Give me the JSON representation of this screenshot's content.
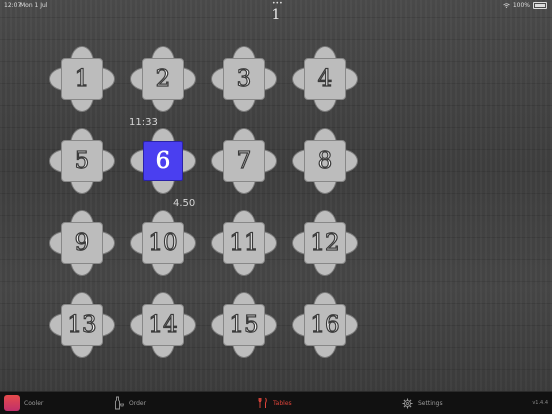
{
  "status_bar": {
    "time": "12:07",
    "date": "Mon 1 Jul",
    "battery": "100%"
  },
  "page": {
    "title": "1"
  },
  "tables": [
    {
      "label": "1"
    },
    {
      "label": "2"
    },
    {
      "label": "3"
    },
    {
      "label": "4"
    },
    {
      "label": "5"
    },
    {
      "label": "6",
      "selected": true
    },
    {
      "label": "7"
    },
    {
      "label": "8"
    },
    {
      "label": "9"
    },
    {
      "label": "10"
    },
    {
      "label": "11"
    },
    {
      "label": "12"
    },
    {
      "label": "13"
    },
    {
      "label": "14"
    },
    {
      "label": "15"
    },
    {
      "label": "16"
    }
  ],
  "table_6_info": {
    "time": "11:33",
    "amount": "4.50"
  },
  "tabbar": {
    "app_label": "Cooler",
    "order_label": "Order",
    "tables_label": "Tables",
    "settings_label": "Settings",
    "version": "v1.4.4"
  },
  "colors": {
    "selected_table": "#4a3ff0",
    "active_tab": "#e0443a"
  }
}
